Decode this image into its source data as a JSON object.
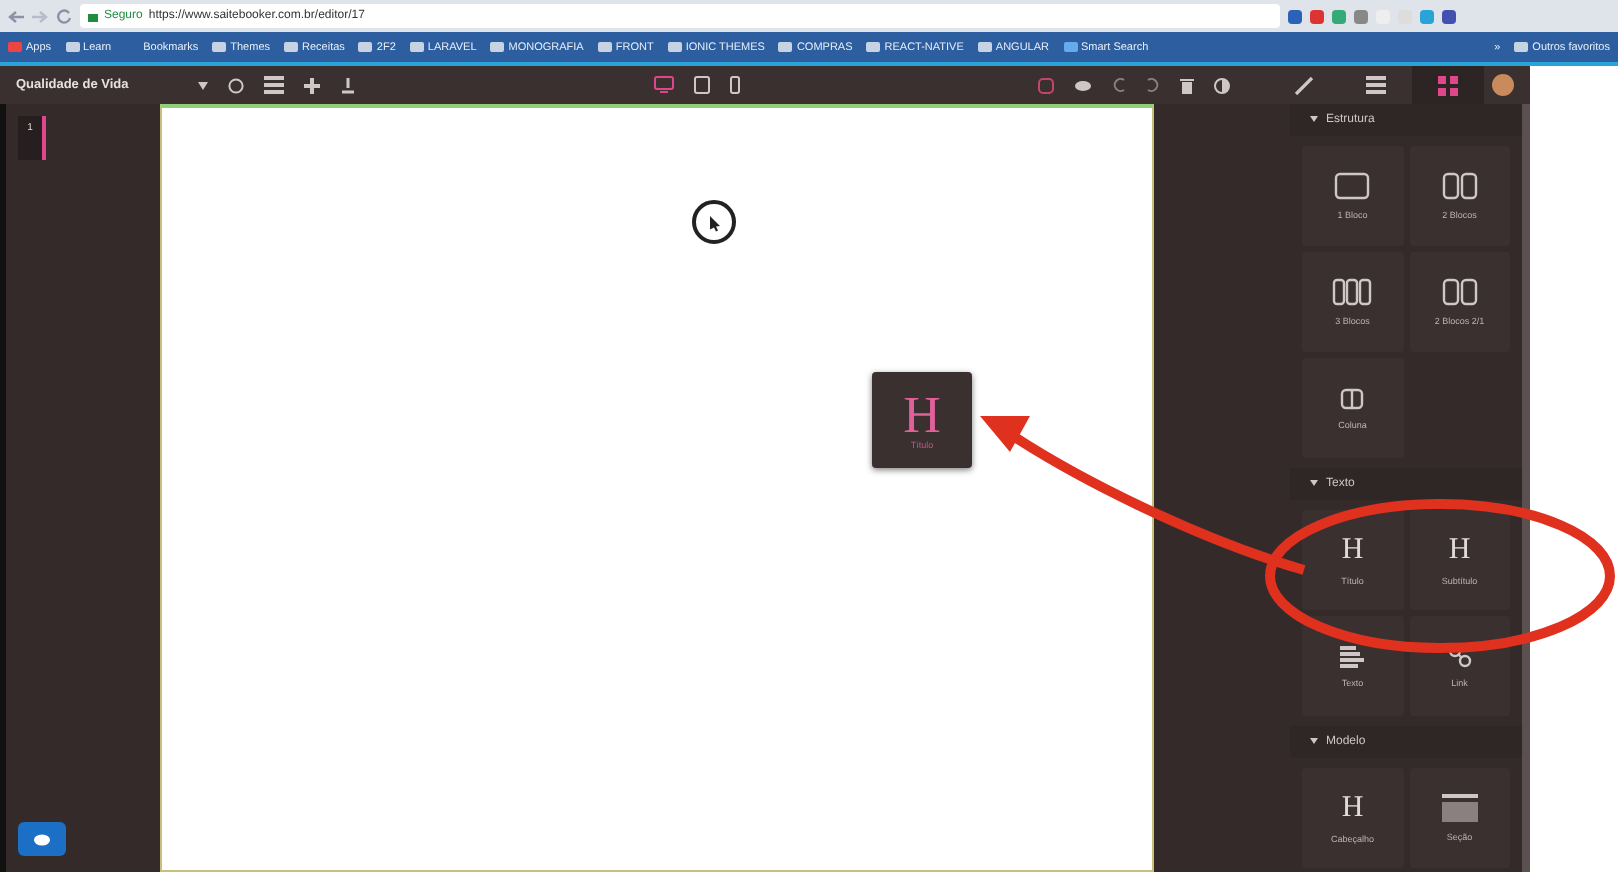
{
  "browser": {
    "secure_label": "Seguro",
    "url": "https://www.saitebooker.com.br/editor/17",
    "bookmarks": [
      {
        "label": "Apps",
        "kind": "apps"
      },
      {
        "label": "Learn",
        "kind": "folder"
      },
      {
        "label": "Bookmarks",
        "kind": "star"
      },
      {
        "label": "Themes",
        "kind": "folder"
      },
      {
        "label": "Receitas",
        "kind": "folder"
      },
      {
        "label": "2F2",
        "kind": "folder"
      },
      {
        "label": "LARAVEL",
        "kind": "folder"
      },
      {
        "label": "MONOGRAFIA",
        "kind": "folder"
      },
      {
        "label": "FRONT",
        "kind": "folder"
      },
      {
        "label": "IONIC THEMES",
        "kind": "folder"
      },
      {
        "label": "COMPRAS",
        "kind": "folder"
      },
      {
        "label": "REACT-NATIVE",
        "kind": "folder"
      },
      {
        "label": "ANGULAR",
        "kind": "folder"
      },
      {
        "label": "Smart Search",
        "kind": "app"
      }
    ],
    "more_label": "»",
    "other_bookmarks": "Outros favoritos"
  },
  "editor": {
    "page_title": "Qualidade de Vida",
    "devices": [
      {
        "kind": "desktop",
        "selected": true
      },
      {
        "kind": "tablet",
        "selected": false
      },
      {
        "kind": "phone",
        "selected": false
      }
    ],
    "panel_tabs": [
      {
        "kind": "brush",
        "selected": false
      },
      {
        "kind": "list",
        "selected": false
      },
      {
        "kind": "grid",
        "selected": true
      }
    ],
    "pages": [
      {
        "label": "1",
        "selected": true
      }
    ],
    "dragged": {
      "glyph": "H",
      "label": "Título"
    },
    "sections": [
      {
        "title": "Estrutura",
        "expanded": true,
        "items": [
          {
            "kind": "block1",
            "label": "1 Bloco"
          },
          {
            "kind": "block2",
            "label": "2 Blocos"
          },
          {
            "kind": "block3",
            "label": "3 Blocos"
          },
          {
            "kind": "block2",
            "label": "2 Blocos 2/1"
          },
          {
            "kind": "column",
            "label": "Coluna"
          }
        ]
      },
      {
        "title": "Texto",
        "expanded": true,
        "items": [
          {
            "kind": "heading",
            "glyph": "H",
            "label": "Título"
          },
          {
            "kind": "heading",
            "glyph": "H",
            "label": "Subtítulo"
          },
          {
            "kind": "text",
            "label": "Texto"
          },
          {
            "kind": "link",
            "label": "Link"
          }
        ]
      },
      {
        "title": "Modelo",
        "expanded": true,
        "items": [
          {
            "kind": "heading",
            "glyph": "H",
            "label": "Cabeçalho"
          },
          {
            "kind": "section",
            "label": "Seção"
          }
        ]
      }
    ]
  }
}
